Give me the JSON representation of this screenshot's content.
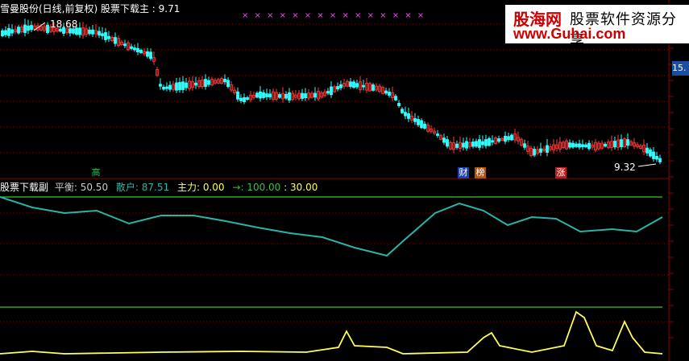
{
  "main_panel": {
    "title": "雪曼股份(日线,前复权)  股票下载主 : 9.71",
    "high_label": "18.68",
    "low_label": "9.32",
    "axis_tag": "15.",
    "signals": [
      {
        "text": "高",
        "color": "#22c55e",
        "bg": "#000"
      },
      {
        "text": "财",
        "color": "#fff",
        "bg": "#1e40af"
      },
      {
        "text": "榜",
        "color": "#fff",
        "bg": "#b45309"
      },
      {
        "text": "涨",
        "color": "#fff",
        "bg": "#b91c1c"
      }
    ],
    "markers": "× × × × × × × × × × × × × × ×"
  },
  "sub_panel": {
    "name": "股票下载副",
    "pingheng_label": "平衡:",
    "pingheng_value": "50.50",
    "sanhu_label": "散户:",
    "sanhu_value": "87.51",
    "zhuli_label": "主力:",
    "zhuli_value": "0.00",
    "arrow_value": "→: 100.00",
    "last_value": ": 30.00"
  },
  "watermark": {
    "brand_cn": "股海网",
    "slogan": "股票软件资源分享",
    "url": "www.Guhai.com"
  },
  "colors": {
    "up": "#ff3b3b",
    "down": "#33ffff",
    "grid": "#8b0000",
    "green_line": "#3fbf3f",
    "sanhu": "#2ab3a6",
    "zhuli": "#ffff55",
    "marker": "#ff44ff"
  }
}
